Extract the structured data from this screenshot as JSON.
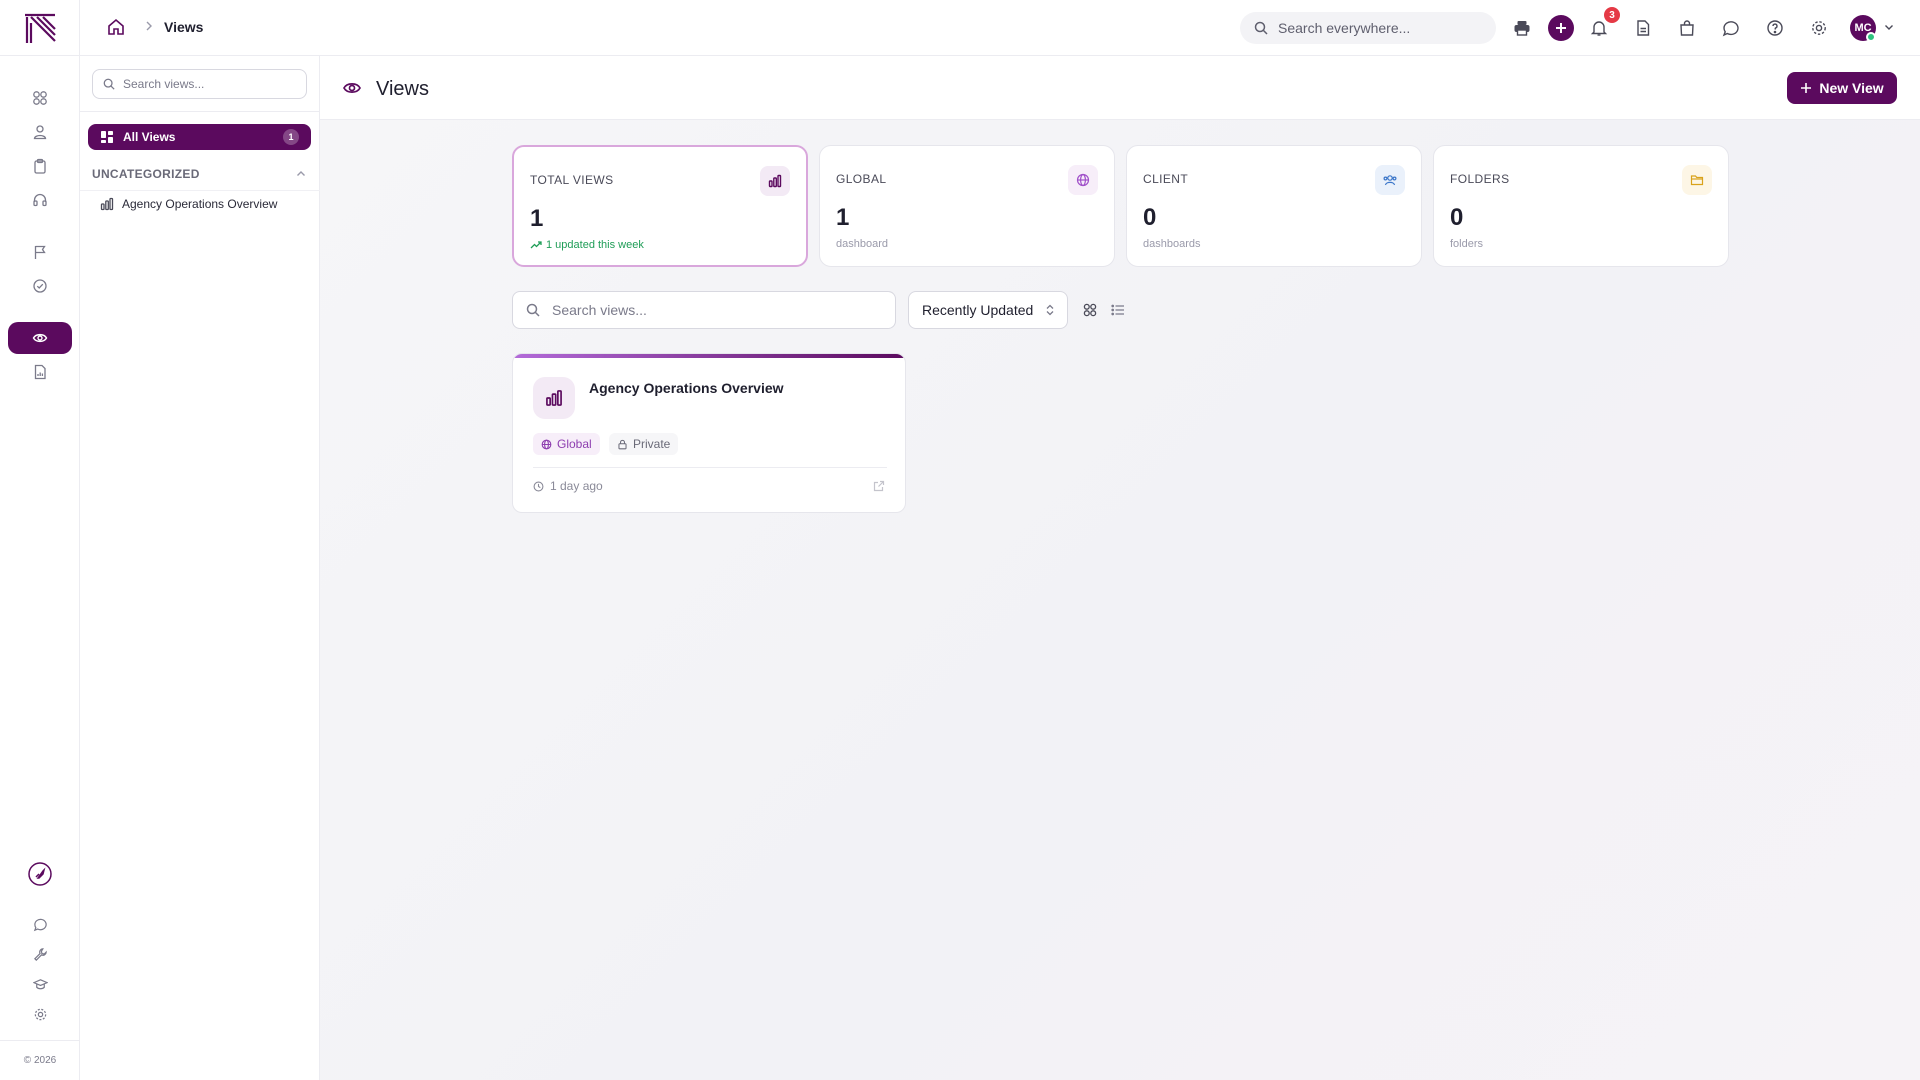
{
  "colors": {
    "brand": "#5b0a5e",
    "accent_light": "#d9a7dc",
    "success": "#1f9d57",
    "danger": "#e53945",
    "online": "#2ec27e"
  },
  "rail": {
    "logo": "brand-logo",
    "items": [
      {
        "icon": "dashboard-grid-icon"
      },
      {
        "icon": "user-icon"
      },
      {
        "icon": "clipboard-icon"
      },
      {
        "icon": "headset-icon"
      },
      {
        "icon": "flag-icon"
      },
      {
        "icon": "badge-check-icon"
      },
      {
        "icon": "eye-icon",
        "active": true
      },
      {
        "icon": "document-chart-icon"
      }
    ],
    "bottom_items": [
      {
        "icon": "rocket-icon"
      },
      {
        "icon": "chat-bubble-icon"
      },
      {
        "icon": "wrench-icon"
      },
      {
        "icon": "graduation-cap-icon"
      },
      {
        "icon": "settings-gear-icon"
      }
    ],
    "footer": "© 2026"
  },
  "topbar": {
    "breadcrumb": {
      "current": "Views"
    },
    "search_placeholder": "Search everywhere...",
    "notifications_count": "3",
    "avatar_initials": "MC"
  },
  "sidebar": {
    "search_placeholder": "Search views...",
    "all_views": {
      "label": "All Views",
      "count": "1"
    },
    "section": "UNCATEGORIZED",
    "items": [
      {
        "label": "Agency Operations Overview"
      }
    ]
  },
  "main": {
    "title": "Views",
    "new_view_label": "New View",
    "stats": [
      {
        "label": "TOTAL VIEWS",
        "value": "1",
        "sub": "1 updated this week",
        "icon": "bar-chart-icon"
      },
      {
        "label": "GLOBAL",
        "value": "1",
        "sub": "dashboard",
        "icon": "globe-icon"
      },
      {
        "label": "CLIENT",
        "value": "0",
        "sub": "dashboards",
        "icon": "client-users-icon"
      },
      {
        "label": "FOLDERS",
        "value": "0",
        "sub": "folders",
        "icon": "folder-icon"
      }
    ],
    "filter": {
      "search_placeholder": "Search views...",
      "sort_value": "Recently Updated",
      "view_mode": "grid"
    },
    "cards": [
      {
        "title": "Agency Operations Overview",
        "tags": [
          "Global",
          "Private"
        ],
        "updated": "1 day ago"
      }
    ]
  }
}
